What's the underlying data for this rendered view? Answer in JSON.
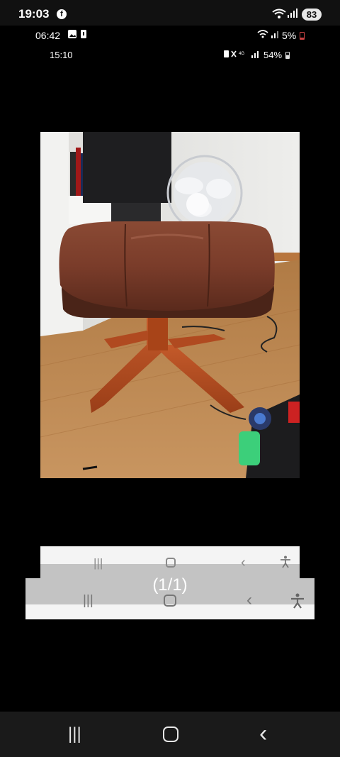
{
  "status_bar": {
    "time": "19:03",
    "app_icon": "facebook-icon",
    "battery": "83"
  },
  "nested_status_bar_1": {
    "time": "06:42",
    "icons": "gallery-icon, battery-saver-icon",
    "battery": "5%"
  },
  "nested_status_bar_2": {
    "time": "15:10",
    "battery": "54%"
  },
  "photo": {
    "subject": "brown leather footstool with wooden four-leg base"
  },
  "gallery": {
    "counter": "(1/1)"
  },
  "system_nav": {
    "recents": "|||",
    "home": "○",
    "back": "‹"
  }
}
